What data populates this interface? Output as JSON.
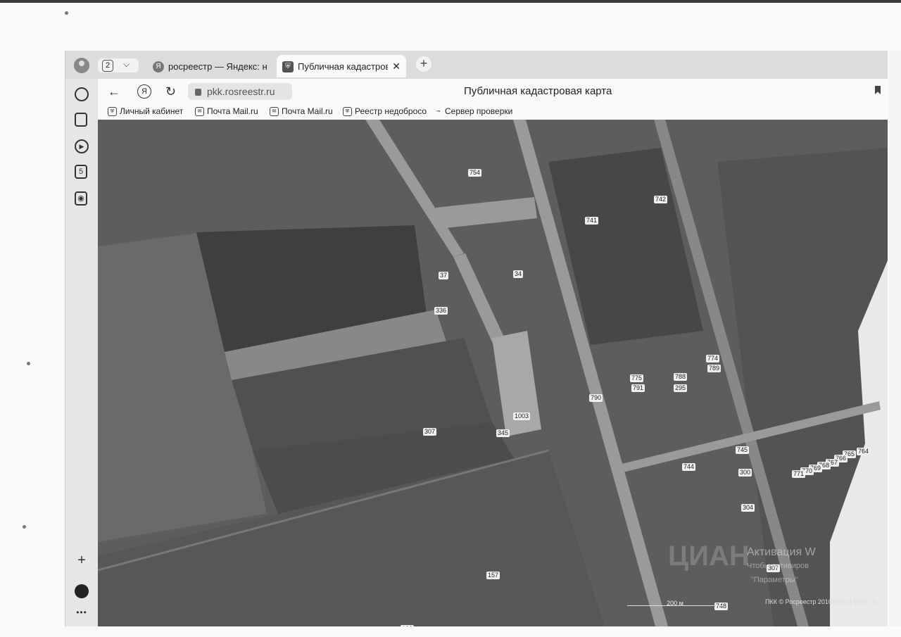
{
  "browser": {
    "tab_count": "2",
    "tabs": [
      {
        "label": "росреестр — Яндекс: нашл",
        "icon": "yandex-icon"
      },
      {
        "label": "Публичная кадастровая карта",
        "icon": "rosreestr-icon",
        "active": true
      }
    ],
    "url": "pkk.rosreestr.ru",
    "page_title": "Публичная кадастровая карта",
    "bookmarks": [
      {
        "label": "Личный кабинет",
        "icon": "emblem-icon"
      },
      {
        "label": "Почта Mail.ru",
        "icon": "mail-icon"
      },
      {
        "label": "Почта Mail.ru",
        "icon": "mail-icon"
      },
      {
        "label": "Реестр недобросо",
        "icon": "emblem-icon"
      },
      {
        "label": "Сервер проверки",
        "icon": "key-icon"
      }
    ],
    "sidebar_icons": [
      "history-icon",
      "collections-icon",
      "play-icon",
      "five-icon",
      "camera-icon",
      "plus-icon",
      "alice-icon",
      "more-icon"
    ]
  },
  "map": {
    "parcel_labels": [
      "754",
      "742",
      "741",
      "37",
      "34",
      "336",
      "774",
      "789",
      "775",
      "791",
      "788",
      "295",
      "790",
      "307",
      "345",
      "1003",
      "745",
      "764",
      "765",
      "766",
      "767",
      "768",
      "769",
      "770",
      "771",
      "744",
      "300",
      "304",
      "307",
      "157",
      "138",
      "748"
    ],
    "scale_label": "200 м",
    "copyright": "ПКК © Росреестр 2010-2024 | ЕЭКО ©",
    "watermark": {
      "logo": "ЦИАН",
      "line1": "Активация W",
      "line2": "Чтобы активиров",
      "line3": "\"Параметры\""
    }
  },
  "colors": {
    "map_bg": "#5d5d5d",
    "road": "#9a9a9a"
  }
}
